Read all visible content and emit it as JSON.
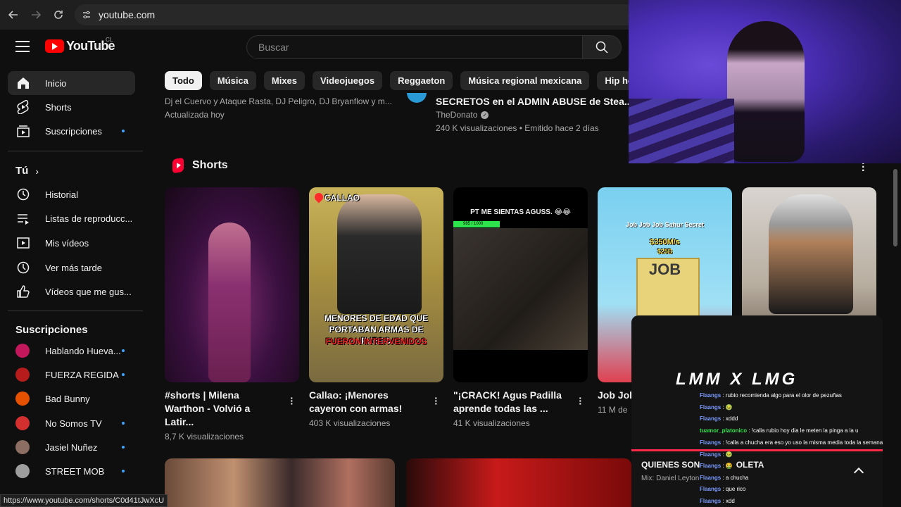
{
  "browser": {
    "url": "youtube.com"
  },
  "header": {
    "logo_text": "YouTube",
    "country": "CL",
    "search_placeholder": "Buscar"
  },
  "sidebar": {
    "main": [
      {
        "label": "Inicio",
        "icon": "home-icon",
        "active": true
      },
      {
        "label": "Shorts",
        "icon": "shorts-icon"
      },
      {
        "label": "Suscripciones",
        "icon": "subscriptions-icon",
        "dot": true
      }
    ],
    "you_heading": "Tú",
    "you": [
      {
        "label": "Historial",
        "icon": "history-icon"
      },
      {
        "label": "Listas de reproducc...",
        "icon": "playlists-icon"
      },
      {
        "label": "Mis vídeos",
        "icon": "my-videos-icon"
      },
      {
        "label": "Ver más tarde",
        "icon": "watch-later-icon"
      },
      {
        "label": "Vídeos que me gus...",
        "icon": "like-icon"
      }
    ],
    "subs_heading": "Suscripciones",
    "subs": [
      {
        "label": "Hablando Hueva...",
        "dot": true,
        "color": "#c2185b"
      },
      {
        "label": "FUERZA REGIDA",
        "dot": true,
        "color": "#b71c1c"
      },
      {
        "label": "Bad Bunny",
        "dot": false,
        "color": "#e65100"
      },
      {
        "label": "No Somos TV",
        "dot": true,
        "color": "#d32f2f"
      },
      {
        "label": "Jasiel Nuñez",
        "dot": true,
        "color": "#8d6e63"
      },
      {
        "label": "STREET MOB",
        "dot": true,
        "color": "#9e9e9e"
      }
    ]
  },
  "chips": [
    "Todo",
    "Música",
    "Mixes",
    "Videojuegos",
    "Reggaeton",
    "Música regional mexicana",
    "Hip hop latino"
  ],
  "top_videos": [
    {
      "subtitle": "Dj el Cuervo y Ataque Rasta, DJ Peligro, DJ Bryanflow y m...",
      "meta": "Actualizada hoy"
    },
    {
      "title": "SECRETOS en el ADMIN ABUSE de Stea...",
      "channel": "TheDonato",
      "meta": "240 K visualizaciones • Emitido hace 2 días"
    }
  ],
  "shorts": {
    "heading": "Shorts",
    "items": [
      {
        "title": "#shorts | Milena Warthon - Volvió a Latir...",
        "views": "8,7 K visualizaciones"
      },
      {
        "title": "Callao: ¡Menores cayeron con armas!",
        "views": "403 K visualizaciones",
        "overlay_top": "CALLAO",
        "overlay_1": "MENORES DE EDAD QUE PORTABAN ARMAS DE FUEGO",
        "overlay_2": "FUERON INTERVENIDOS"
      },
      {
        "title": "\"¡CRACK! Agus Padilla aprende todas las ...",
        "views": "41 K visualizaciones",
        "overlay_top": "PT ME SIENTAS AGUSS. 😂😂",
        "bar": "985 / 1000"
      },
      {
        "title": "Job Job",
        "views": "11 M de",
        "overlay_1": "Job Job Job Sahur Secret",
        "overlay_2": "$350M/s",
        "overlay_3": "$25B",
        "overlay_4": "JOB"
      },
      {
        "title": "",
        "views": ""
      }
    ]
  },
  "chat": {
    "title": "LMM X LMG",
    "messages": [
      {
        "user": "Flaangs",
        "text": ": rubio recomienda algo para el olor de pezuñas"
      },
      {
        "user": "Flaangs",
        "text": ": 🤢"
      },
      {
        "user": "Flaangs",
        "text": ": xddd"
      },
      {
        "user": "tuamor_platonico",
        "text": ": !calla rubio hoy dia le meten la pinga a la u",
        "green": true
      },
      {
        "user": "Flaangs",
        "text": ": !calla a chucha era eso yo uso la misma media toda la semana"
      },
      {
        "user": "Flaangs",
        "text": ": 🤢"
      },
      {
        "user": "Flaangs",
        "text": ": 🤮"
      },
      {
        "user": "Flaangs",
        "text": ": a chucha"
      },
      {
        "user": "Flaangs",
        "text": ": que rico"
      },
      {
        "user": "Flaangs",
        "text": ": xdd"
      }
    ],
    "now_playing": "QUIENES SON",
    "now_playing_rest": "OLETA",
    "mix": "Mix: Daniel Leyton"
  },
  "status_url": "https://www.youtube.com/shorts/C0d41tJwXcU"
}
